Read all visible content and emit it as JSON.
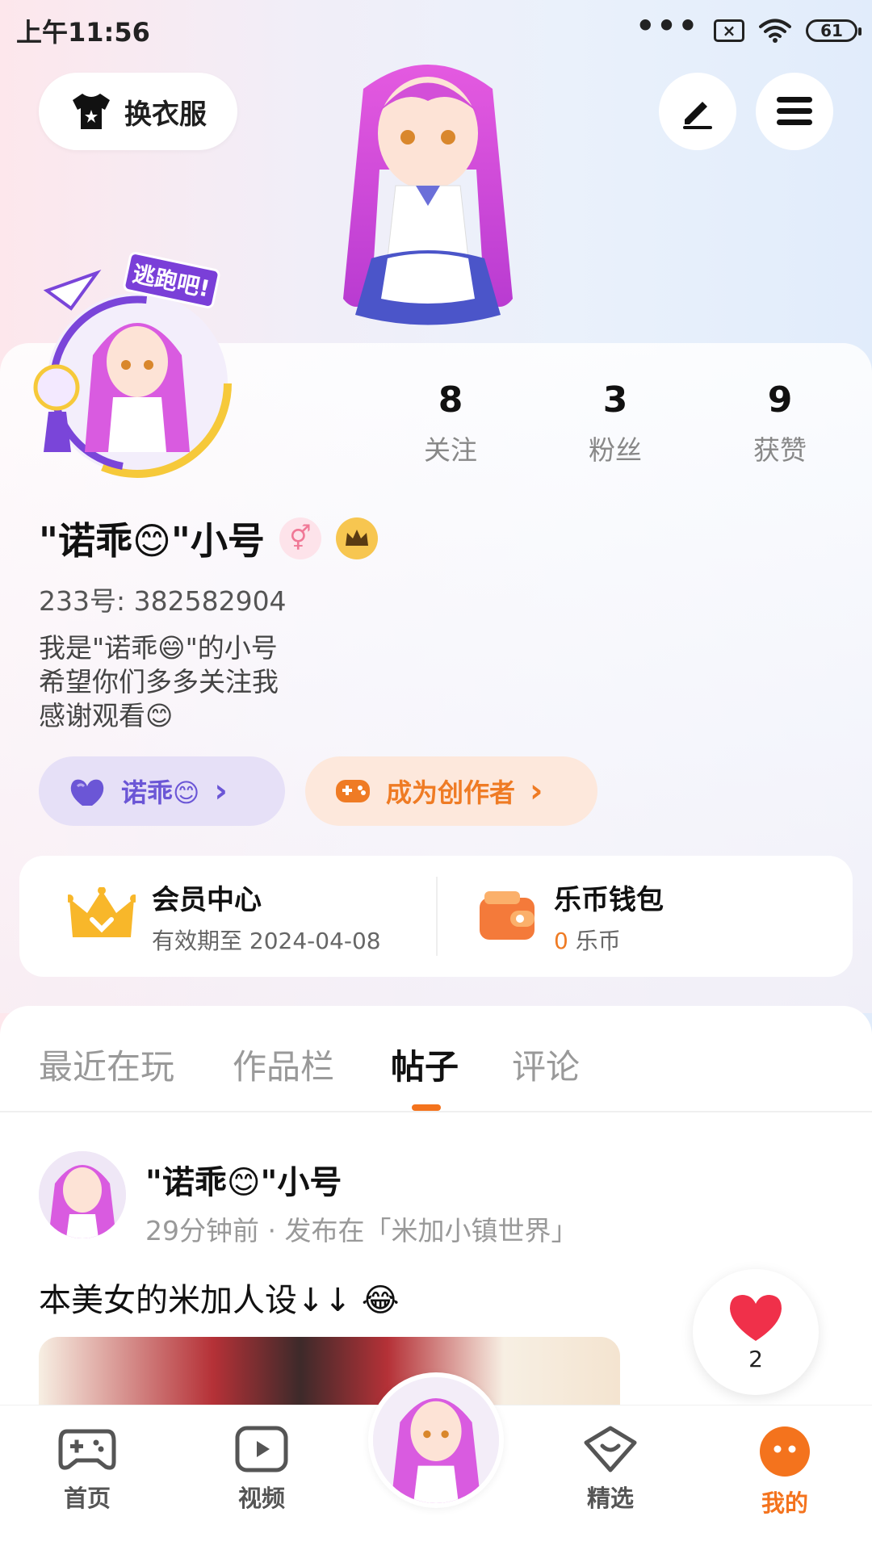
{
  "status_bar": {
    "time": "上午11:56",
    "dots": "•••",
    "sim": "×",
    "battery": "61"
  },
  "header": {
    "outfit_button_label": "换衣服",
    "outfit_icon": "tshirt-icon",
    "edit_icon": "edit-icon",
    "menu_icon": "menu-icon"
  },
  "profile": {
    "avatar_badge": "逃跑吧!",
    "stats": [
      {
        "value": "8",
        "label": "关注"
      },
      {
        "value": "3",
        "label": "粉丝"
      },
      {
        "value": "9",
        "label": "获赞"
      }
    ],
    "name": "\"诺乖😊\"小号",
    "gender_symbol": "⚥",
    "user_id": "233号: 382582904",
    "bio_lines": [
      "我是\"诺乖😄\"的小号",
      "希望你们多多关注我",
      "感谢观看😊"
    ],
    "fan_pill_label": "诺乖😊",
    "creator_pill_label": "成为创作者",
    "chevron": "›"
  },
  "member": {
    "title": "会员中心",
    "subtitle": "有效期至 2024-04-08"
  },
  "wallet": {
    "title": "乐币钱包",
    "amount": "0",
    "unit": "乐币"
  },
  "tabs": [
    {
      "label": "最近在玩",
      "active": false
    },
    {
      "label": "作品栏",
      "active": false
    },
    {
      "label": "帖子",
      "active": true
    },
    {
      "label": "评论",
      "active": false
    }
  ],
  "post": {
    "author": "\"诺乖😊\"小号",
    "meta": "29分钟前 · 发布在「米加小镇世界」",
    "text": "本美女的米加人设↓↓ 😂",
    "likes": "2"
  },
  "bottom_nav": [
    {
      "label": "首页",
      "icon": "gamepad-icon",
      "active": false
    },
    {
      "label": "视频",
      "icon": "video-icon",
      "active": false
    },
    {
      "label": "精选",
      "icon": "heart-badge-icon",
      "active": false
    },
    {
      "label": "我的",
      "icon": "profile-face-icon",
      "active": true
    }
  ],
  "colors": {
    "accent": "#f4731d",
    "fan_pill": "#6b56d6",
    "creator_pill": "#ef7b24",
    "like": "#f0304a"
  }
}
